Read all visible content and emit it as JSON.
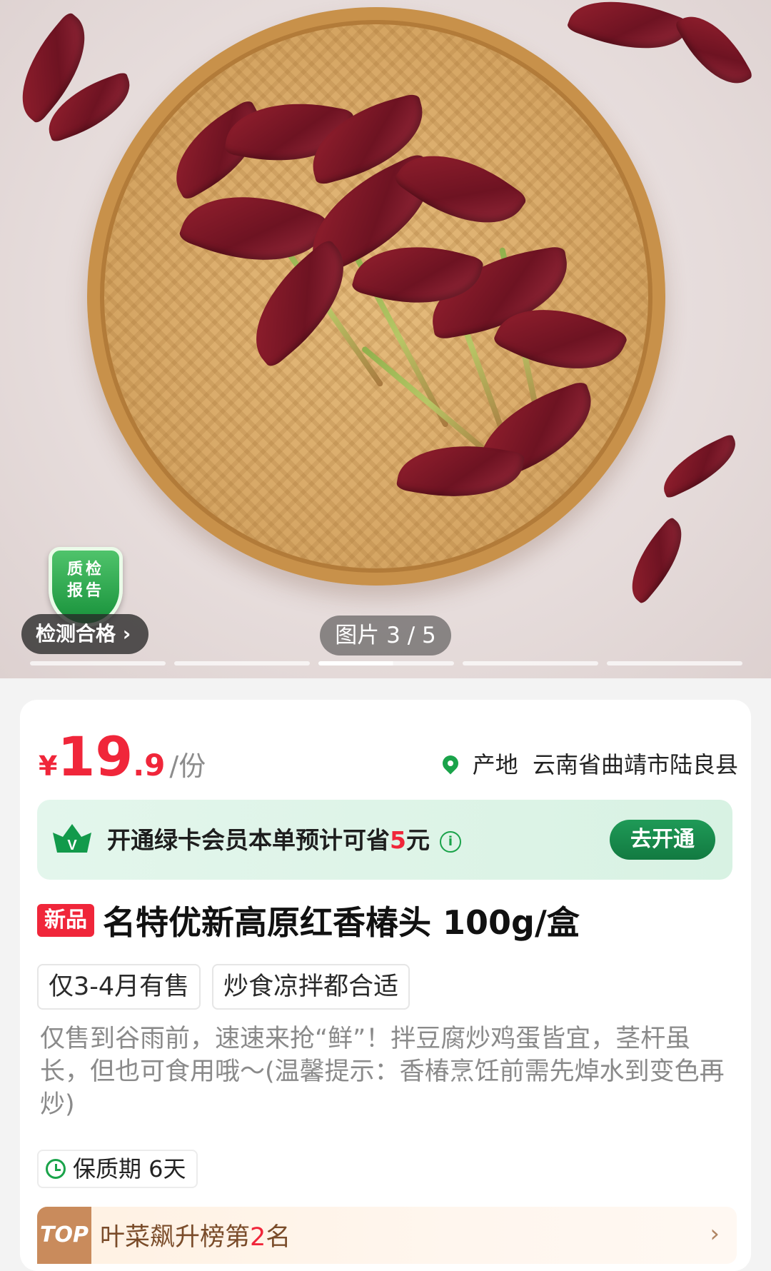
{
  "gallery": {
    "counter_text": "图片 3 / 5",
    "total_dots": 5,
    "active_index": 3
  },
  "quality": {
    "shield_line1": "质检",
    "shield_line2": "报告",
    "pill_label": "检测合格 ›"
  },
  "price": {
    "currency": "¥",
    "integer": "19",
    "decimal": ".9",
    "unit": "/份"
  },
  "origin": {
    "label": "产地",
    "value": "云南省曲靖市陆良县"
  },
  "membership": {
    "text_prefix": "开通绿卡会员本单预计可省",
    "saving": "5",
    "text_suffix": "元",
    "info_icon": "i",
    "button_label": "去开通",
    "crown_letter": "V"
  },
  "product": {
    "badge": "新品",
    "title": "名特优新高原红香椿头 100g/盒",
    "tags": [
      "仅3-4月有售",
      "炒食凉拌都合适"
    ],
    "description": "仅售到谷雨前，速速来抢“鲜”！拌豆腐炒鸡蛋皆宜，茎杆虽长，但也可食用哦～(温馨提示：香椿烹饪前需先焯水到变色再炒)",
    "shelf_life": "保质期 6天"
  },
  "ranking": {
    "badge": "TOP",
    "text_prefix": "叶菜飙升榜第",
    "rank_number": "2",
    "text_suffix": "名",
    "arrow": "›"
  },
  "colors": {
    "price_red": "#f0263a",
    "member_green": "#1aa34a"
  }
}
